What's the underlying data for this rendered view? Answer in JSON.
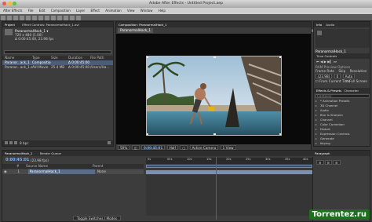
{
  "window": {
    "title": "Adobe After Effects - Untitled Project.aep"
  },
  "menu": [
    "After Effects",
    "File",
    "Edit",
    "Composition",
    "Layer",
    "Effect",
    "Animation",
    "View",
    "Window",
    "Help"
  ],
  "workspace": {
    "label": "Workspace:",
    "value": "Standard"
  },
  "project": {
    "tab": "Project",
    "tab2": "Effect Controls: ParanormalHack_1.avi",
    "item_name": "ParanormalHack_1 ▾",
    "item_info1": "720 x 480 (1.00)",
    "item_info2": "Δ 0:00:45:00, 23.98 fps",
    "columns": [
      "Name",
      "Type",
      "Size",
      "Duration",
      "File Path"
    ],
    "rows": [
      {
        "name": "Paranor...ack_1",
        "type": "Composition",
        "size": "",
        "duration": "Δ 0:00:45:00",
        "path": ""
      },
      {
        "name": "Paranor...ack_1.avi",
        "type": "AVI Movie",
        "size": "25.4 MB",
        "duration": "Δ 0:00:45:00",
        "path": "/Users/Ha..."
      }
    ],
    "bpc": "8 bpc"
  },
  "composition": {
    "tab": "Composition: ParanormalHack_1",
    "subtab": "ParanormalHack_1",
    "zoom": "50%",
    "timecode": "0:00:45:01",
    "resolution": "Half",
    "camera": "Active Camera",
    "view": "1 View"
  },
  "info": {
    "tab1": "Info",
    "tab2": "Audio"
  },
  "right": {
    "comp_label": "ParanormalHack_1",
    "preview_tab": "Time Controls",
    "ram_preview": "RAM Preview Options",
    "frame_rate_label": "Frame Rate",
    "skip_label": "Skip",
    "resolution_label": "Resolution",
    "frame_rate": "(23.98)",
    "skip": "0",
    "resolution": "Auto",
    "from_current": "From Current Time",
    "full_screen": "Full Screen",
    "effects_tab": "Effects & Presets",
    "character_tab": "Character",
    "search_placeholder": "Contains:",
    "effects": [
      "* Animation Presets",
      "3D Channel",
      "Audio",
      "Blur & Sharpen",
      "Channel",
      "Color Correction",
      "Distort",
      "Expression Controls",
      "Generate",
      "Keying"
    ]
  },
  "paragraph": {
    "tab": "Paragraph"
  },
  "timeline": {
    "tab": "ParanormalHack_1",
    "tab_render": "Render Queue",
    "timecode": "0:00:45:01",
    "fps": "(23.98 fps)",
    "columns": [
      "#",
      "Source Name",
      "Parent"
    ],
    "layer": {
      "index": "1",
      "name": "ParanormalHack_1",
      "parent": "None"
    },
    "ruler": [
      "0s",
      "05s",
      "10s",
      "15s",
      "20s",
      "25s",
      "30s",
      "35s",
      "40s"
    ],
    "toggle": "Toggle Switches / Modes"
  },
  "watermark": "Torrentez.ru",
  "colors": {
    "accent": "#6fb3ff",
    "playhead": "#d53030",
    "watermark": "#1e6f1e"
  }
}
